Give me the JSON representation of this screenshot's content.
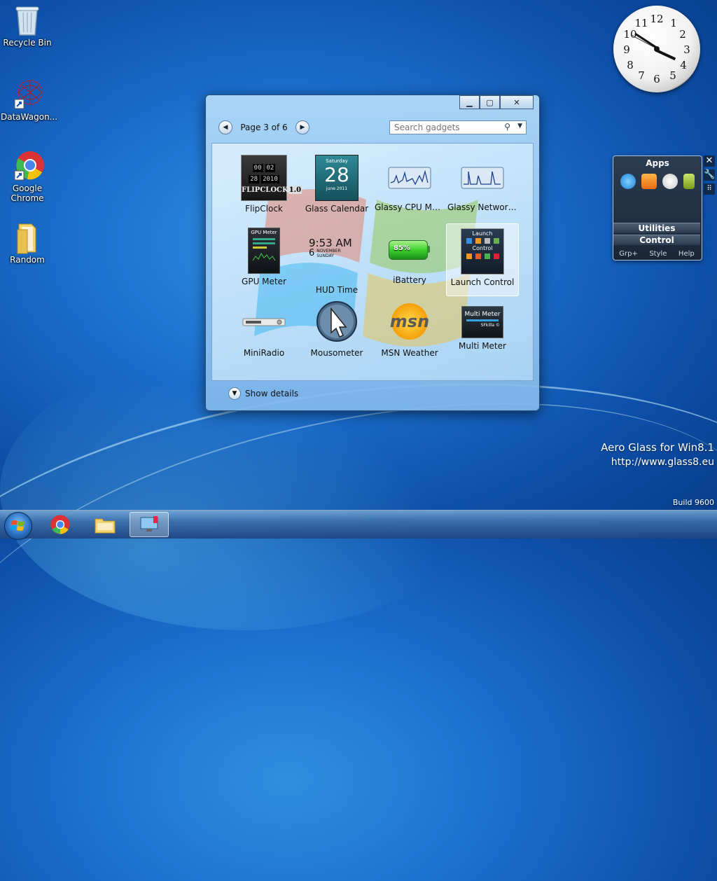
{
  "desktop": {
    "icons": [
      {
        "label": "Recycle Bin",
        "icon": "recycle-bin-icon"
      },
      {
        "label": "DataWagon...",
        "icon": "datawagon-icon"
      },
      {
        "label": "Google Chrome",
        "icon": "chrome-icon"
      },
      {
        "label": "Random",
        "icon": "folder-icon"
      }
    ]
  },
  "clock": {
    "numbers": [
      "12",
      "1",
      "2",
      "3",
      "4",
      "5",
      "6",
      "7",
      "8",
      "9",
      "10",
      "11"
    ]
  },
  "gadget_window": {
    "page_label": "Page 3 of 6",
    "search_placeholder": "Search gadgets",
    "show_details": "Show details",
    "gadgets": [
      {
        "name": "FlipClock"
      },
      {
        "name": "Glass Calendar",
        "day": "Saturday",
        "date": "28",
        "month": "june 2011"
      },
      {
        "name": "Glassy CPU Mo..."
      },
      {
        "name": "Glassy Network ..."
      },
      {
        "name": "GPU Meter",
        "thumb_title": "GPU Meter"
      },
      {
        "name": "HUD Time",
        "time": "9:53 AM",
        "day_num": "6",
        "month": "NOVEMBER",
        "weekday": "SUNDAY"
      },
      {
        "name": "iBattery",
        "percent": "85%"
      },
      {
        "name": "Launch Control",
        "top": "Launch",
        "mid": "Control"
      },
      {
        "name": "MiniRadio"
      },
      {
        "name": "Mousometer"
      },
      {
        "name": "MSN Weather",
        "logo": "msn"
      },
      {
        "name": "Multi Meter",
        "thumb_title": "Multi Meter",
        "thumb_sub": "SFkilla ©"
      }
    ],
    "flipclock_digits": [
      "00",
      "02",
      "28",
      "2010"
    ],
    "flipclock_logo": "FLIPCLOCK",
    "flipclock_version": "1.0"
  },
  "launch_control": {
    "header": "Apps",
    "utilities": "Utilities",
    "control": "Control",
    "footer": [
      "Grp+",
      "Style",
      "Help"
    ],
    "side_buttons": [
      "close-icon",
      "wrench-icon",
      "grip-icon"
    ]
  },
  "watermark": {
    "line1": "Aero Glass for Win8.1",
    "line2": "http://www.glass8.eu",
    "build": "Build 9600"
  },
  "taskbar": {
    "items": [
      "chrome-icon",
      "file-explorer-icon",
      "gadgets-icon"
    ]
  },
  "colors": {
    "desktop_blue": "#1c6fce",
    "window_glass": "#b4dcfa",
    "battery_green": "#3ccf2c"
  }
}
